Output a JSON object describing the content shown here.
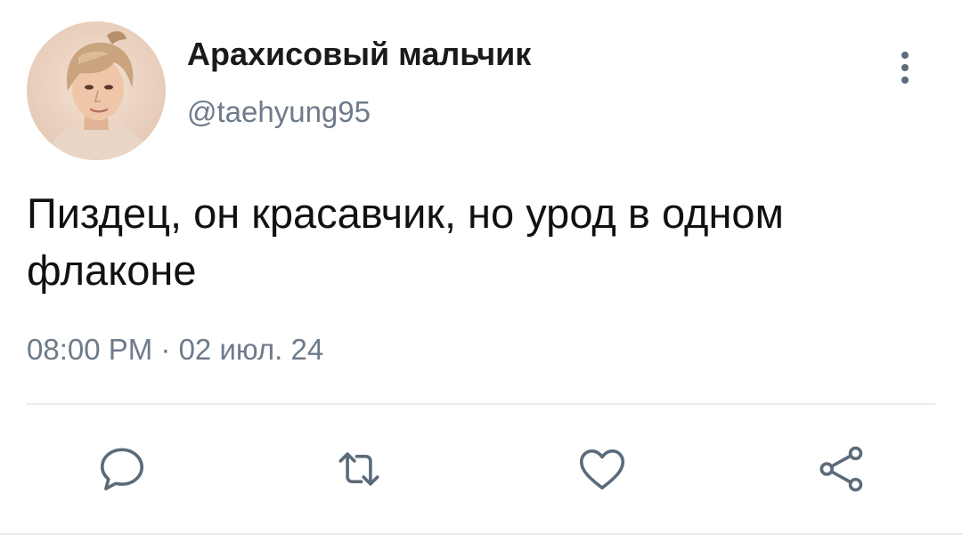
{
  "tweet": {
    "author": {
      "display_name": "Арахисовый мальчик",
      "handle": "@taehyung95",
      "avatar": "profile-photo"
    },
    "text": "Пиздец, он красавчик, но урод в одном флаконе",
    "timestamp": "08:00 PM · 02 июл. 24"
  },
  "header": {
    "more_icon": "more-vertical-icon"
  },
  "actions": [
    {
      "name": "reply",
      "icon": "reply-icon"
    },
    {
      "name": "retweet",
      "icon": "retweet-icon"
    },
    {
      "name": "like",
      "icon": "heart-icon"
    },
    {
      "name": "share",
      "icon": "share-icon"
    }
  ],
  "colors": {
    "icon": "#5b6b7a",
    "secondary_text": "#6e7b8a",
    "divider": "#e6ecf0"
  }
}
